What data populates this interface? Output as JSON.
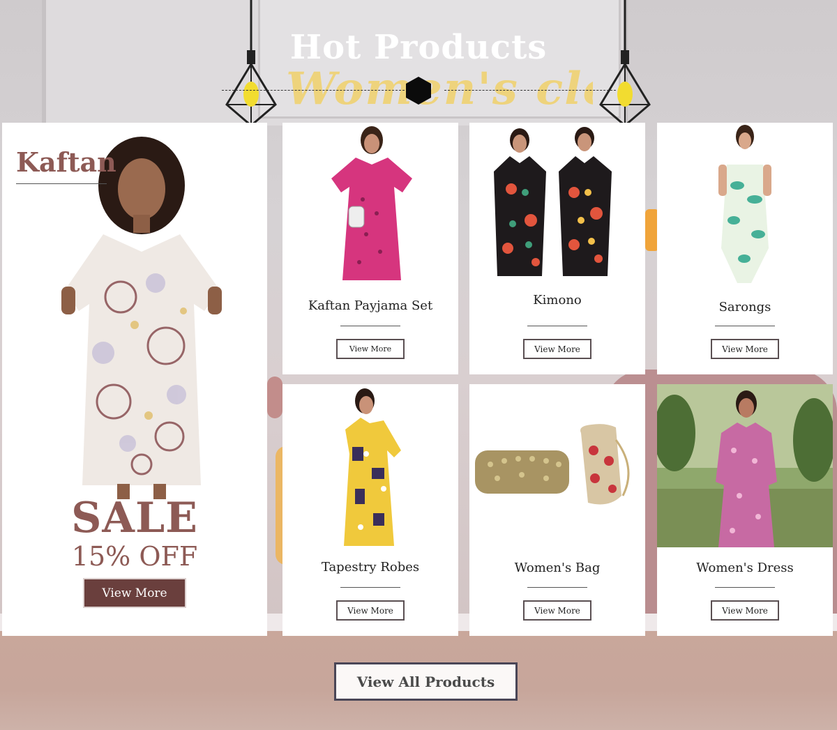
{
  "header": {
    "title": "Hot Products"
  },
  "feature": {
    "title": "Kaftan",
    "sale": "SALE",
    "discount": "15% OFF",
    "button": "View More"
  },
  "products": [
    {
      "name": "Kaftan Payjama Set",
      "button": "View More"
    },
    {
      "name": "Kimono",
      "button": "View More"
    },
    {
      "name": "Sarongs",
      "button": "View More"
    },
    {
      "name": "Tapestry Robes",
      "button": "View More"
    },
    {
      "name": "Women's Bag",
      "button": "View More"
    },
    {
      "name": "Women's Dress",
      "button": "View More"
    }
  ],
  "footer": {
    "view_all": "View All Products"
  },
  "colors": {
    "brand": "#8d5a55",
    "feature_button": "#6a3f3d",
    "title_text": "#ffffff",
    "border": "#4a4657"
  }
}
